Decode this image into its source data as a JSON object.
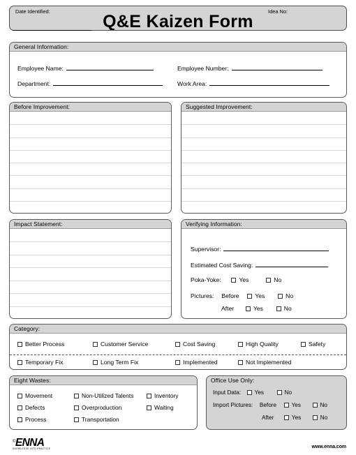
{
  "header": {
    "date_identified_label": "Date Identified:",
    "idea_no_label": "Idea No:",
    "title": "Q&E Kaizen Form"
  },
  "general_information": {
    "section_title": "General Information:",
    "fields": [
      {
        "label": "Employee Name:"
      },
      {
        "label": "Employee Number:"
      },
      {
        "label": "Department:"
      },
      {
        "label": "Work Area:"
      }
    ]
  },
  "before_improvement": {
    "section_title": "Before Improvement:",
    "line_count": 7
  },
  "suggested_improvement": {
    "section_title": "Suggested Improvement:",
    "line_count": 7
  },
  "impact_statement": {
    "section_title": "Impact Statement:",
    "line_count": 6
  },
  "verifying_information": {
    "section_title": "Verifying Information:",
    "supervisor_label": "Supervisor:",
    "cost_saving_label": "Estimated Cost Saving:",
    "poka_yoke_label": "Poka-Yoke:",
    "poka_yoke_yes": "Yes",
    "poka_yoke_no": "No",
    "pictures_label": "Pictures:",
    "pictures_before_label": "Before",
    "pictures_before_yes": "Yes",
    "pictures_before_no": "No",
    "pictures_after_label": "After",
    "pictures_after_yes": "Yes",
    "pictures_after_no": "No"
  },
  "category": {
    "section_title": "Category:",
    "row1": [
      "Better Process",
      "Customer Service",
      "Cost Saving",
      "High Quality",
      "Safety"
    ],
    "row2": [
      "Temporary Fix",
      "Long Term Fix",
      "Implemented",
      "Not Implemented"
    ]
  },
  "eight_wastes": {
    "section_title": "Eight Wastes:",
    "col1": [
      "Movement",
      "Defects",
      "Process"
    ],
    "col2": [
      "Non-Utilized Talents",
      "Overproduction",
      "Transportation"
    ],
    "col3": [
      "Inventory",
      "Waiting"
    ]
  },
  "office_use": {
    "section_title": "Office Use Only:",
    "input_data_label": "Input Data:",
    "input_data_yes": "Yes",
    "input_data_no": "No",
    "import_pictures_label": "Import Pictures:",
    "import_before_label": "Before",
    "import_before_yes": "Yes",
    "import_before_no": "No",
    "import_after_label": "After",
    "import_after_yes": "Yes",
    "import_after_no": "No"
  },
  "footer": {
    "logo_copyright": "©",
    "logo_text": "ENNA",
    "logo_tagline": "KNOWLEDGE INTO PRACTICE",
    "url": "www.enna.com"
  },
  "colors": {
    "header_fill": "#d4d4d4",
    "border": "#5a5a5a",
    "rule_line": "#d8d8d8"
  }
}
